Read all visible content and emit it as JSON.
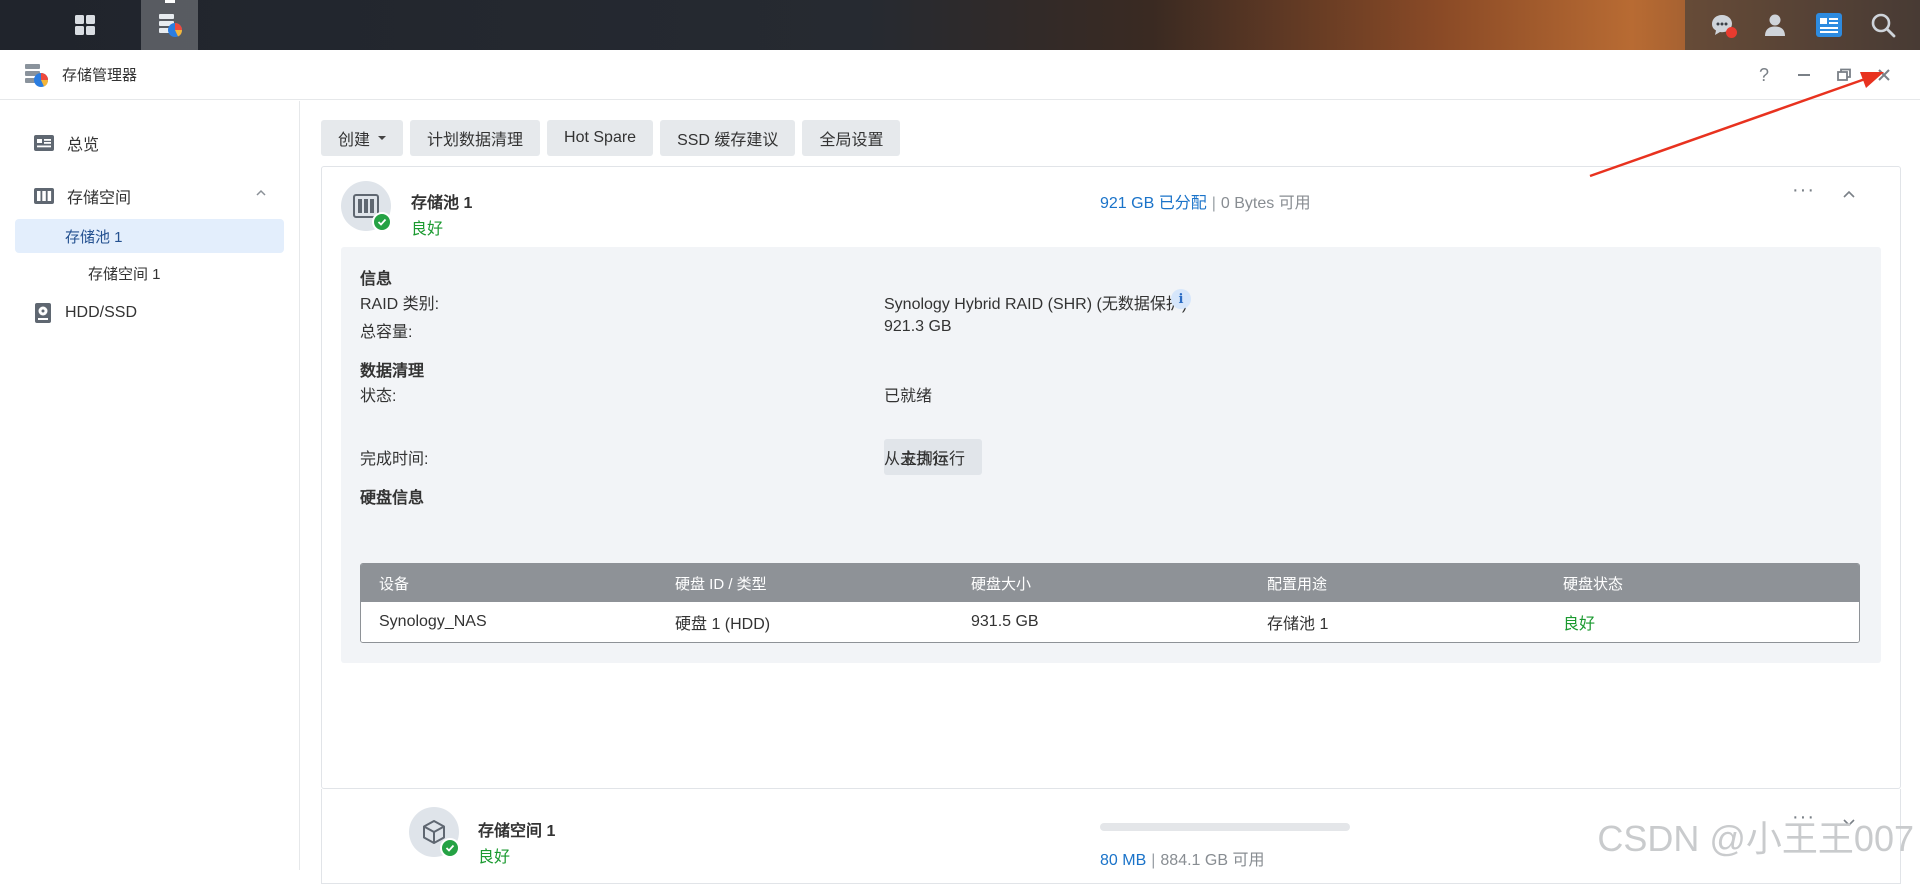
{
  "taskbar": {
    "main_menu_icon": "grid-icon",
    "app_icon": "storage-manager-icon"
  },
  "window": {
    "title": "存储管理器",
    "controls": {
      "help": "?",
      "minimize": "–",
      "restore": "❐",
      "close": "✕"
    }
  },
  "sidebar": {
    "overview": "总览",
    "storage": "存储空间",
    "pool": "存储池 1",
    "volume": "存储空间 1",
    "hdd": "HDD/SSD"
  },
  "toolbar": {
    "create": "创建",
    "scrub": "计划数据清理",
    "hot_spare": "Hot Spare",
    "ssd": "SSD 缓存建议",
    "global": "全局设置"
  },
  "pool": {
    "name": "存储池 1",
    "status": "良好",
    "allocated": "921 GB 已分配",
    "sep": "|",
    "available": "0 Bytes 可用",
    "more": "···"
  },
  "info": {
    "heading": "信息",
    "raid_label": "RAID 类别:",
    "raid_value": "Synology Hybrid RAID (SHR) (无数据保护)",
    "info_icon": "i",
    "capacity_label": "总容量:",
    "capacity_value": "921.3 GB"
  },
  "scrub": {
    "heading": "数据清理",
    "status_label": "状态:",
    "status_value": "已就绪",
    "run_button": "立即运行",
    "time_label": "完成时间:",
    "time_value": "从未执行"
  },
  "disks": {
    "heading": "硬盘信息",
    "columns": [
      "设备",
      "硬盘 ID / 类型",
      "硬盘大小",
      "配置用途",
      "硬盘状态"
    ],
    "rows": [
      {
        "device": "Synology_NAS",
        "id": "硬盘 1 (HDD)",
        "size": "931.5 GB",
        "usage": "存储池 1",
        "status": "良好"
      }
    ]
  },
  "volume": {
    "name": "存储空间 1",
    "status": "良好",
    "used": "80 MB",
    "sep": "|",
    "available": "884.1 GB 可用",
    "usage_fraction": 0.0001,
    "more": "···"
  },
  "watermark": "CSDN @小王王007",
  "colors": {
    "good": "#1b9a30",
    "accent": "#1a73c9",
    "annotation_arrow": "#e8321f"
  }
}
